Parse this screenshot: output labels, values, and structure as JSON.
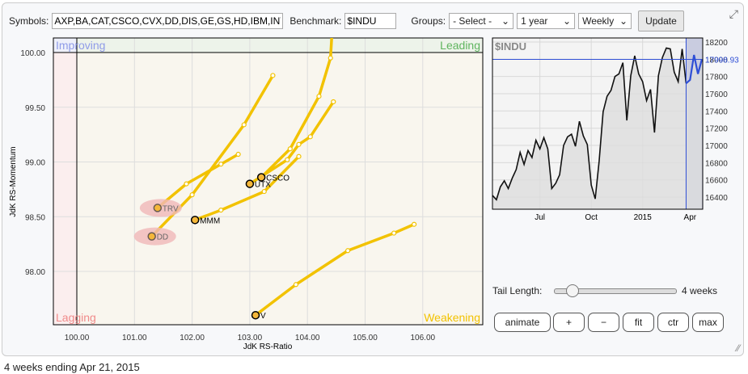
{
  "toolbar": {
    "symbols_label": "Symbols:",
    "symbols_value": "AXP,BA,CAT,CSCO,CVX,DD,DIS,GE,GS,HD,IBM,INTC",
    "benchmark_label": "Benchmark:",
    "benchmark_value": "$INDU",
    "groups_label": "Groups:",
    "groups_value": "- Select -",
    "period_value": "1 year",
    "interval_value": "Weekly",
    "update_label": "Update"
  },
  "rrg": {
    "quadrants": {
      "improving": "Improving",
      "leading": "Leading",
      "lagging": "Lagging",
      "weakening": "Weakening"
    },
    "xlabel": "JdK RS-Ratio",
    "ylabel": "JdK RS-Momentum",
    "xticks": [
      "100.00",
      "101.00",
      "102.00",
      "103.00",
      "104.00",
      "105.00",
      "106.00"
    ],
    "yticks": [
      "100.00",
      "99.50",
      "99.00",
      "98.50",
      "98.00"
    ],
    "colors": {
      "tail": "#f2c200",
      "head": "#f5b73a",
      "highlight": "#f0b8b8"
    },
    "series": [
      {
        "name": "CSCO",
        "points": [
          [
            104.45,
            100.4
          ],
          [
            104.4,
            99.95
          ],
          [
            104.2,
            99.6
          ],
          [
            103.7,
            99.12
          ],
          [
            103.2,
            98.86
          ]
        ]
      },
      {
        "name": "UTX",
        "points": [
          [
            104.45,
            99.55
          ],
          [
            104.05,
            99.23
          ],
          [
            103.85,
            99.16
          ],
          [
            103.65,
            99.02
          ],
          [
            103.0,
            98.8
          ]
        ]
      },
      {
        "name": "TRV",
        "points": [
          [
            102.8,
            99.07
          ],
          [
            102.5,
            98.98
          ],
          [
            101.9,
            98.8
          ],
          [
            101.4,
            98.58
          ]
        ],
        "highlight": true
      },
      {
        "name": "DD",
        "points": [
          [
            103.4,
            99.79
          ],
          [
            102.9,
            99.34
          ],
          [
            102.0,
            98.7
          ],
          [
            101.3,
            98.32
          ]
        ],
        "highlight": true
      },
      {
        "name": "MMM",
        "points": [
          [
            103.85,
            99.05
          ],
          [
            103.25,
            98.73
          ],
          [
            102.5,
            98.56
          ],
          [
            102.05,
            98.47
          ]
        ]
      },
      {
        "name": "V",
        "points": [
          [
            105.85,
            98.43
          ],
          [
            105.5,
            98.35
          ],
          [
            104.7,
            98.19
          ],
          [
            103.8,
            97.88
          ],
          [
            103.1,
            97.6
          ]
        ]
      }
    ]
  },
  "benchmark": {
    "title": "$INDU",
    "last_value": "17998.93",
    "yticks": [
      "18200",
      "18000",
      "17800",
      "17600",
      "17400",
      "17200",
      "17000",
      "16800",
      "16600",
      "16400"
    ],
    "xticks": [
      "Jul",
      "Oct",
      "2015",
      "Apr"
    ],
    "values": [
      16420,
      16370,
      16520,
      16590,
      16500,
      16620,
      16720,
      16920,
      16780,
      16940,
      16860,
      17060,
      16960,
      17090,
      16960,
      16500,
      16560,
      16660,
      17000,
      17100,
      17130,
      16990,
      17280,
      17110,
      17010,
      16540,
      16380,
      16820,
      17390,
      17570,
      17640,
      17800,
      17830,
      17960,
      17290,
      17810,
      18040,
      17830,
      17740,
      17520,
      17650,
      17150,
      17810,
      18020,
      18130,
      18120,
      17850,
      17740,
      18120,
      17720,
      17760,
      18050,
      17830,
      18000
    ],
    "highlight_last": 5
  },
  "controls": {
    "tail_label": "Tail Length:",
    "tail_value": "4 weeks",
    "tail_fraction": 0.1,
    "buttons": [
      "animate",
      "+",
      "−",
      "fit",
      "ctr",
      "max"
    ]
  },
  "footer": "4 weeks ending Apr 21, 2015"
}
